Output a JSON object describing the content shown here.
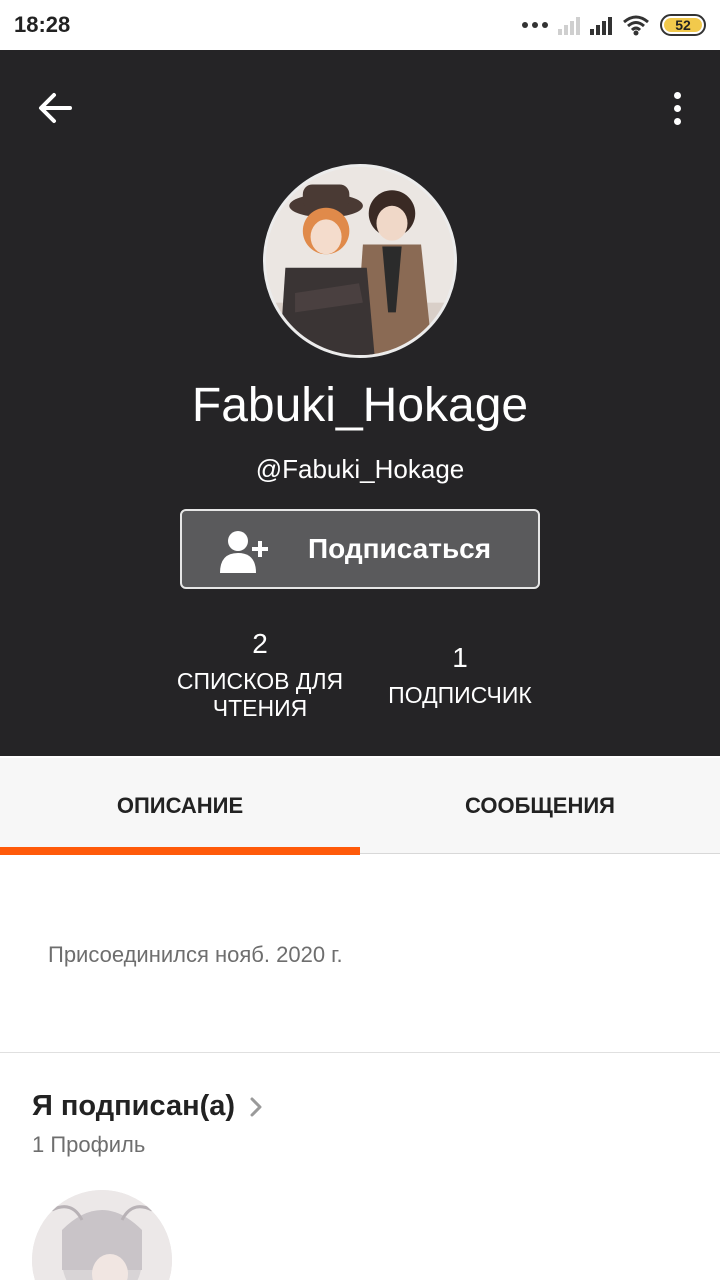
{
  "status_bar": {
    "time": "18:28",
    "battery": "52"
  },
  "profile": {
    "display_name": "Fabuki_Hokage",
    "username": "@Fabuki_Hokage",
    "follow_label": "Подписаться"
  },
  "stats": {
    "reading_lists_value": "2",
    "reading_lists_label_line1": "СПИСКОВ ДЛЯ",
    "reading_lists_label_line2": "ЧТЕНИЯ",
    "followers_value": "1",
    "followers_label": "ПОДПИСЧИК"
  },
  "tabs": [
    {
      "label": "ОПИСАНИЕ",
      "active": true
    },
    {
      "label": "СООБЩЕНИЯ",
      "active": false
    }
  ],
  "about": {
    "joined": "Присоединился нояб. 2020 г."
  },
  "following": {
    "title": "Я подписан(а)",
    "count": "1 Профиль"
  },
  "colors": {
    "header_bg": "#252426",
    "accent": "#ff5a0a",
    "button_bg": "#5a5a5c"
  },
  "icons": {
    "back": "arrow-left-icon",
    "more": "more-vertical-icon",
    "follow": "add-user-icon",
    "chevron": "chevron-right-icon"
  }
}
